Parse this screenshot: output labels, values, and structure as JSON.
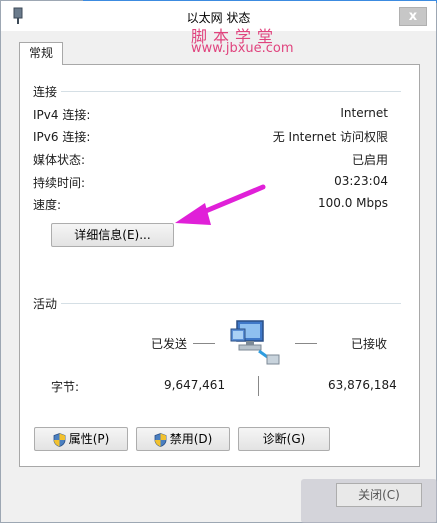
{
  "window": {
    "title": "以太网 状态",
    "close_label": "x"
  },
  "watermark": {
    "line1": "脚本学堂",
    "line2": "www.jbxue.com"
  },
  "tabs": [
    {
      "label": "常规"
    }
  ],
  "connection": {
    "group_label": "连接",
    "rows": [
      {
        "label": "IPv4 连接:",
        "value": "Internet"
      },
      {
        "label": "IPv6 连接:",
        "value": "无 Internet 访问权限"
      },
      {
        "label": "媒体状态:",
        "value": "已启用"
      },
      {
        "label": "持续时间:",
        "value": "03:23:04"
      },
      {
        "label": "速度:",
        "value": "100.0 Mbps"
      }
    ],
    "details_button": "详细信息(E)..."
  },
  "activity": {
    "group_label": "活动",
    "sent_label": "已发送",
    "received_label": "已接收",
    "bytes_label": "字节:",
    "bytes_sent": "9,647,461",
    "bytes_received": "63,876,184"
  },
  "buttons": {
    "properties": "属性(P)",
    "disable": "禁用(D)",
    "diagnose": "诊断(G)",
    "close": "关闭(C)"
  },
  "colors": {
    "accent_arrow": "#e020d8",
    "watermark": "#e0447e",
    "title_strip": "#3c8be0"
  }
}
